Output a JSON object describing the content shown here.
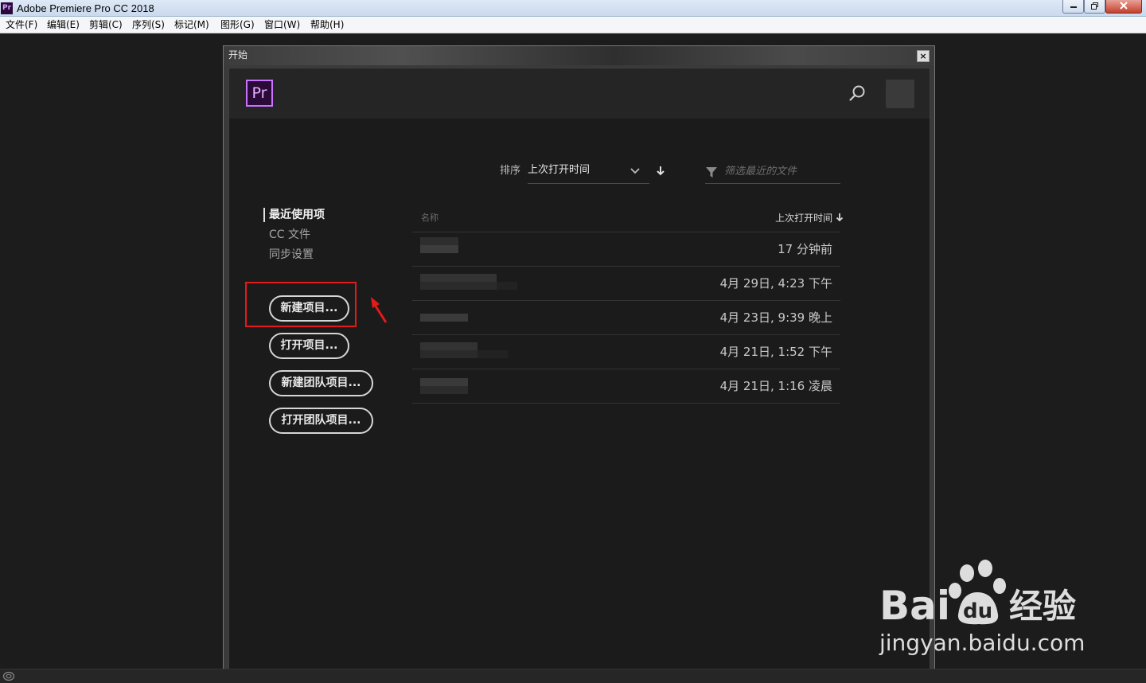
{
  "window": {
    "app_icon_text": "Pr",
    "title": "Adobe Premiere Pro CC 2018"
  },
  "menu": [
    "文件(F)",
    "编辑(E)",
    "剪辑(C)",
    "序列(S)",
    "标记(M)",
    "图形(G)",
    "窗口(W)",
    "帮助(H)"
  ],
  "dialog": {
    "title": "开始",
    "close_label": "×",
    "logo_text": "Pr",
    "sort": {
      "label": "排序",
      "value": "上次打开时间"
    },
    "filter": {
      "placeholder": "筛选最近的文件"
    },
    "nav": {
      "recent": "最近使用项",
      "cc_files": "CC 文件",
      "sync_settings": "同步设置"
    },
    "buttons": {
      "new_project": "新建项目...",
      "open_project": "打开项目...",
      "new_team_project": "新建团队项目...",
      "open_team_project": "打开团队项目..."
    },
    "table": {
      "col_name": "名称",
      "col_time": "上次打开时间",
      "rows": [
        {
          "time": "17 分钟前"
        },
        {
          "time": "4月 29日, 4:23 下午"
        },
        {
          "time": "4月 23日, 9:39 晚上"
        },
        {
          "time": "4月 21日, 1:52 下午"
        },
        {
          "time": "4月 21日, 1:16 凌晨"
        }
      ]
    }
  },
  "watermark": {
    "brand": "Bai",
    "brand_tail": "du",
    "chinese": "经验",
    "url": "jingyan.baidu.com"
  },
  "icons": {
    "search": "search-icon",
    "filter": "filter-icon",
    "sort_direction": "arrow-down-icon",
    "dropdown": "chevron-down-icon"
  },
  "colors": {
    "accent_purple": "#c874ff",
    "highlight_red": "#e21a1a"
  }
}
